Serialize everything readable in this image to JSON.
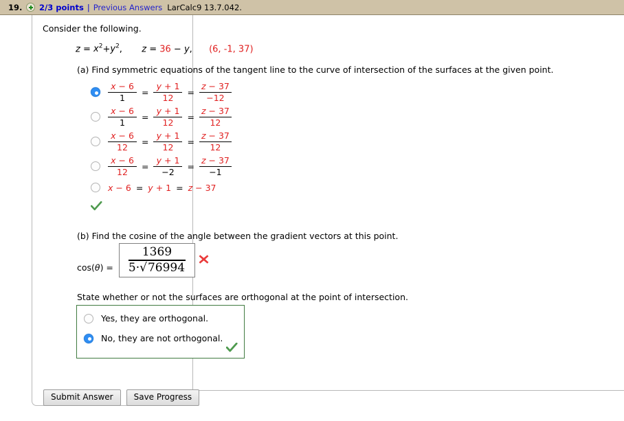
{
  "header": {
    "question_number": "19.",
    "plus_icon": "plus-circle-icon",
    "points": "2/3 points",
    "separator": "|",
    "previous_answers": "Previous Answers",
    "source_code": "LarCalc9 13.7.042."
  },
  "body": {
    "consider": "Consider the following.",
    "given": {
      "eq1_lhs": "z",
      "eq1_eq": "=",
      "eq1_x": "x",
      "eq1_xexp": "2",
      "eq1_plus": "+",
      "eq1_y": "y",
      "eq1_yexp": "2",
      "eq1_comma": ",",
      "eq2_lhs": "z",
      "eq2_eq": "=",
      "eq2_num": "36",
      "eq2_minus": "−",
      "eq2_var": "y",
      "eq2_comma": ",",
      "point": "(6, -1, 37)"
    },
    "part_a": {
      "prompt": "(a) Find symmetric equations of the tangent line to the curve of intersection of the surfaces at the given point.",
      "selected_index": 0,
      "choices": [
        {
          "type": "fraction",
          "selected": true,
          "terms": [
            {
              "num_var": "x",
              "num_op": "−",
              "num_val": "6",
              "den": "1",
              "den_red": false
            },
            {
              "num_var": "y",
              "num_op": "+",
              "num_val": "1",
              "den": "12",
              "den_red": true
            },
            {
              "num_var": "z",
              "num_op": "−",
              "num_val": "37",
              "den": "−12",
              "den_red": true
            }
          ]
        },
        {
          "type": "fraction",
          "selected": false,
          "terms": [
            {
              "num_var": "x",
              "num_op": "−",
              "num_val": "6",
              "den": "1",
              "den_red": false
            },
            {
              "num_var": "y",
              "num_op": "+",
              "num_val": "1",
              "den": "12",
              "den_red": true
            },
            {
              "num_var": "z",
              "num_op": "−",
              "num_val": "37",
              "den": "12",
              "den_red": true
            }
          ]
        },
        {
          "type": "fraction",
          "selected": false,
          "terms": [
            {
              "num_var": "x",
              "num_op": "−",
              "num_val": "6",
              "den": "12",
              "den_red": true
            },
            {
              "num_var": "y",
              "num_op": "+",
              "num_val": "1",
              "den": "12",
              "den_red": true
            },
            {
              "num_var": "z",
              "num_op": "−",
              "num_val": "37",
              "den": "12",
              "den_red": true
            }
          ]
        },
        {
          "type": "fraction",
          "selected": false,
          "terms": [
            {
              "num_var": "x",
              "num_op": "−",
              "num_val": "6",
              "den": "12",
              "den_red": true
            },
            {
              "num_var": "y",
              "num_op": "+",
              "num_val": "1",
              "den": "−2",
              "den_red": false
            },
            {
              "num_var": "z",
              "num_op": "−",
              "num_val": "37",
              "den": "−1",
              "den_red": false
            }
          ]
        },
        {
          "type": "inline",
          "selected": false,
          "text_parts": [
            {
              "var": "x",
              "op": "−",
              "val": "6"
            },
            {
              "var": "y",
              "op": "+",
              "val": "1"
            },
            {
              "var": "z",
              "op": "−",
              "val": "37"
            }
          ]
        }
      ],
      "result_icon": "green-check-icon"
    },
    "part_b": {
      "prompt": "(b) Find the cosine of the angle between the gradient vectors at this point.",
      "label_prefix": "cos(",
      "label_theta": "θ",
      "label_suffix": ") =",
      "answer_numerator": "1369",
      "answer_denominator": "5 · √76994",
      "answer_den_coef": "5",
      "answer_den_dot": "·",
      "answer_den_radicand": "76994",
      "result_icon": "red-x-icon"
    },
    "orthogonal": {
      "prompt": "State whether or not the surfaces are orthogonal at the point of intersection.",
      "selected_index": 1,
      "options": [
        {
          "label": "Yes, they are orthogonal.",
          "selected": false
        },
        {
          "label": "No, they are not orthogonal.",
          "selected": true
        }
      ],
      "result_icon": "green-check-icon"
    }
  },
  "footer": {
    "submit_label": "Submit Answer",
    "save_label": "Save Progress"
  },
  "colors": {
    "header_bg": "#cfc2a7",
    "link": "#2222cc",
    "points": "#0000cc",
    "red": "#e02020",
    "green": "#3f9a3f",
    "radio_selected": "#2f8ef4",
    "green_box_border": "#3f7a3f"
  }
}
